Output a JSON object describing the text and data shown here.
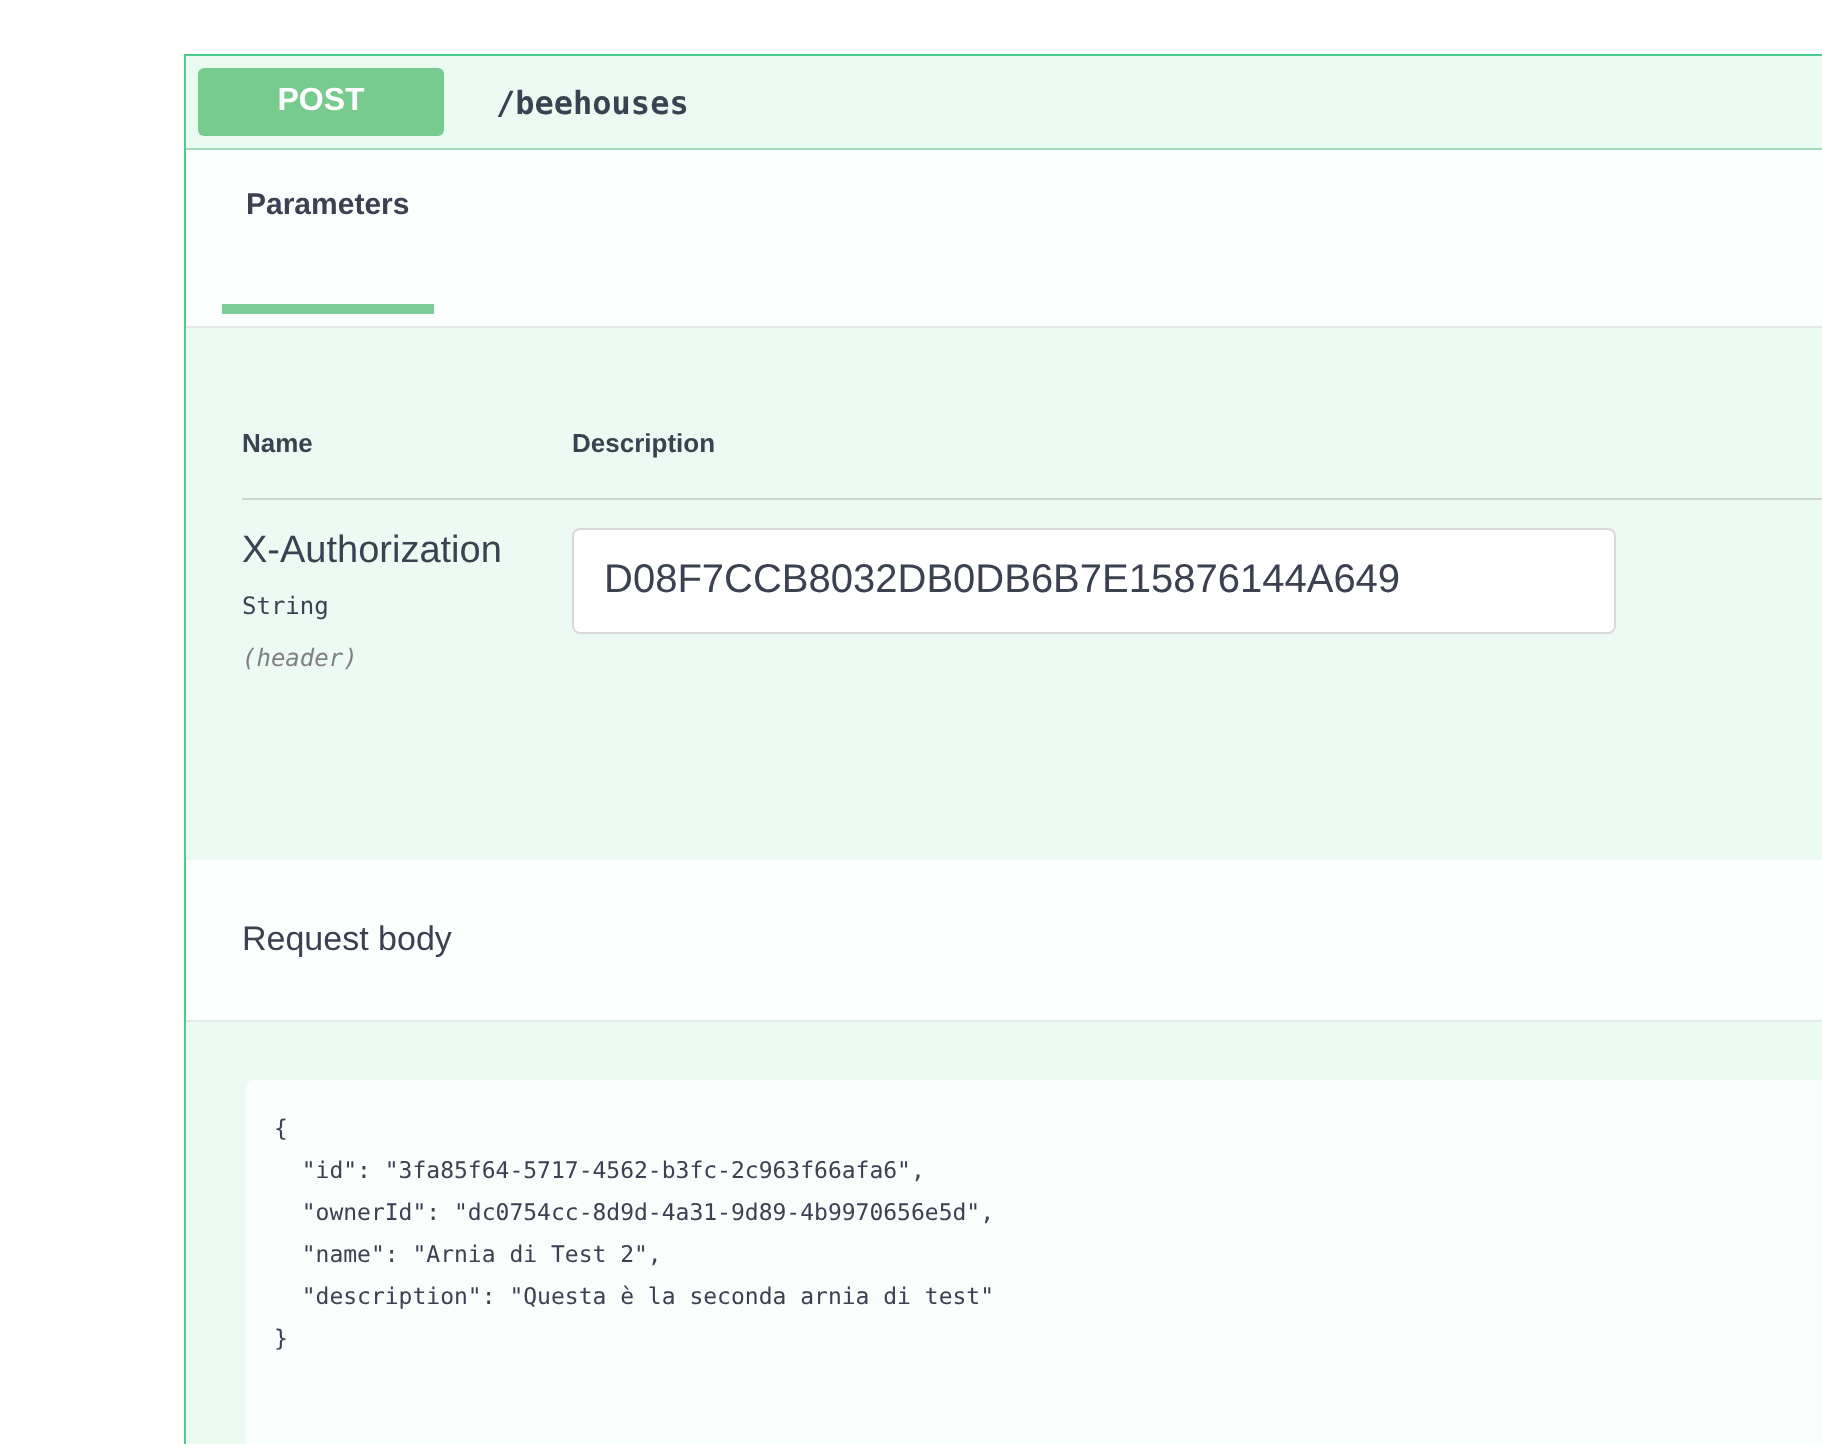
{
  "operation": {
    "method": "POST",
    "path": "/beehouses"
  },
  "tabs": [
    {
      "label": "Parameters",
      "selected": true
    }
  ],
  "parameters": {
    "columns": [
      "Name",
      "Description"
    ],
    "rows": [
      {
        "name": "X-Authorization",
        "type": "String",
        "location": "(header)",
        "value": "D08F7CCB8032DB0DB6B7E15876144A649"
      }
    ]
  },
  "request_body": {
    "title": "Request body",
    "example": "{\n  \"id\": \"3fa85f64-5717-4562-b3fc-2c963f66afa6\",\n  \"ownerId\": \"dc0754cc-8d9d-4a31-9d89-4b9970656e5d\",\n  \"name\": \"Arnia di Test 2\",\n  \"description\": \"Questa è la seconda arnia di test\"\n}"
  }
}
